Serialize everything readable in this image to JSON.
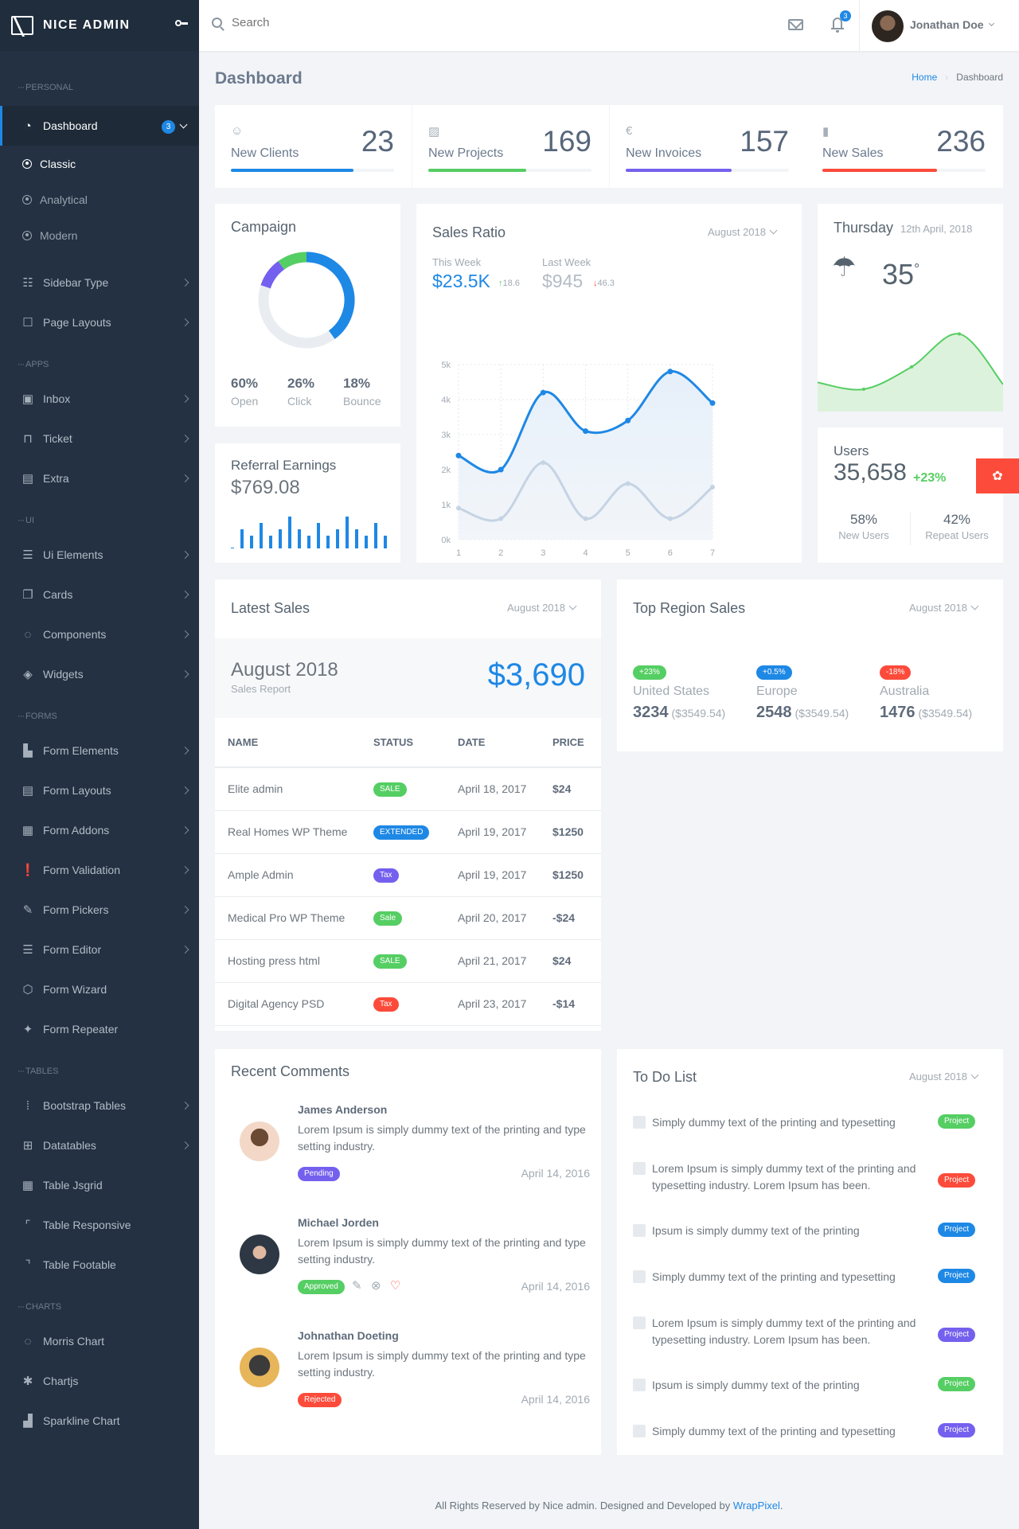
{
  "brand": {
    "name": "NICE ADMIN"
  },
  "search": {
    "placeholder": "Search"
  },
  "header": {
    "notification_count": "3",
    "user_name": "Jonathan Doe"
  },
  "page": {
    "title": "Dashboard",
    "breadcrumb": [
      "Home",
      "Dashboard"
    ]
  },
  "sidebar": {
    "sections": {
      "personal": "PERSONAL",
      "apps": "APPS",
      "ui": "UI",
      "forms": "FORMS",
      "tables": "TABLES",
      "charts": "CHARTS"
    },
    "dashboard": {
      "label": "Dashboard",
      "badge": "3",
      "subitems": [
        "Classic",
        "Analytical",
        "Modern"
      ]
    },
    "personal_items": [
      "Sidebar Type",
      "Page Layouts"
    ],
    "apps_items": [
      "Inbox",
      "Ticket",
      "Extra"
    ],
    "ui_items": [
      "Ui Elements",
      "Cards",
      "Components",
      "Widgets"
    ],
    "forms_items": [
      "Form Elements",
      "Form Layouts",
      "Form Addons",
      "Form Validation",
      "Form Pickers",
      "Form Editor",
      "Form Wizard",
      "Form Repeater"
    ],
    "tables_items": [
      "Bootstrap Tables",
      "Datatables",
      "Table Jsgrid",
      "Table Responsive",
      "Table Footable"
    ],
    "charts_items": [
      "Morris Chart",
      "Chartjs",
      "Sparkline Chart"
    ]
  },
  "stats": [
    {
      "label": "New Clients",
      "value": "23",
      "icon": "smile-icon",
      "progress": 0.75,
      "color": "#1e88e5"
    },
    {
      "label": "New Projects",
      "value": "169",
      "icon": "image-icon",
      "progress": 0.6,
      "color": "#55ce63"
    },
    {
      "label": "New Invoices",
      "value": "157",
      "icon": "euro-icon",
      "progress": 0.65,
      "color": "#7460ee"
    },
    {
      "label": "New Sales",
      "value": "236",
      "icon": "bar-chart-icon",
      "progress": 0.7,
      "color": "#fc4b3b"
    }
  ],
  "campaign": {
    "title": "Campaign",
    "stats": [
      {
        "value": "60%",
        "label": "Open"
      },
      {
        "value": "26%",
        "label": "Click"
      },
      {
        "value": "18%",
        "label": "Bounce"
      }
    ]
  },
  "referral": {
    "title": "Referral Earnings",
    "amount": "$769.08"
  },
  "sales_ratio": {
    "title": "Sales Ratio",
    "period": "August 2018",
    "this_week_label": "This Week",
    "this_week_value": "$23.5K",
    "this_week_change": "18.6",
    "last_week_label": "Last Week",
    "last_week_value": "$945",
    "last_week_change": "46.3"
  },
  "weather": {
    "day": "Thursday",
    "date": "12th April, 2018",
    "temp": "35",
    "unit": "°"
  },
  "users": {
    "title": "Users",
    "count": "35,658",
    "change": "+23%",
    "new_pct": "58%",
    "new_label": "New Users",
    "repeat_pct": "42%",
    "repeat_label": "Repeat Users"
  },
  "latest_sales": {
    "title": "Latest Sales",
    "period": "August 2018",
    "report_month": "August 2018",
    "report_label": "Sales Report",
    "total": "$3,690",
    "columns": [
      "NAME",
      "STATUS",
      "DATE",
      "PRICE"
    ],
    "rows": [
      {
        "name": "Elite admin",
        "status": "SALE",
        "status_color": "#55ce63",
        "date": "April 18, 2017",
        "price": "$24"
      },
      {
        "name": "Real Homes WP Theme",
        "status": "EXTENDED",
        "status_color": "#1e88e5",
        "date": "April 19, 2017",
        "price": "$1250"
      },
      {
        "name": "Ample Admin",
        "status": "Tax",
        "status_color": "#7460ee",
        "date": "April 19, 2017",
        "price": "$1250"
      },
      {
        "name": "Medical Pro WP Theme",
        "status": "Sale",
        "status_color": "#55ce63",
        "date": "April 20, 2017",
        "price": "-$24"
      },
      {
        "name": "Hosting press html",
        "status": "SALE",
        "status_color": "#55ce63",
        "date": "April 21, 2017",
        "price": "$24"
      },
      {
        "name": "Digital Agency PSD",
        "status": "Tax",
        "status_color": "#fc4b3b",
        "date": "April 23, 2017",
        "price": "-$14"
      }
    ]
  },
  "top_region": {
    "title": "Top Region Sales",
    "period": "August 2018",
    "regions": [
      {
        "change": "+23%",
        "color": "#55ce63",
        "name": "United States",
        "count": "3234",
        "amount": "($3549.54)"
      },
      {
        "change": "+0.5%",
        "color": "#1e88e5",
        "name": "Europe",
        "count": "2548",
        "amount": "($3549.54)"
      },
      {
        "change": "-18%",
        "color": "#fc4b3b",
        "name": "Australia",
        "count": "1476",
        "amount": "($3549.54)"
      }
    ]
  },
  "comments": {
    "title": "Recent Comments",
    "items": [
      {
        "name": "James Anderson",
        "text": "Lorem Ipsum is simply dummy text of the printing and type setting industry.",
        "status": "Pending",
        "status_color": "#7460ee",
        "date": "April 14, 2016"
      },
      {
        "name": "Michael Jorden",
        "text": "Lorem Ipsum is simply dummy text of the printing and type setting industry.",
        "status": "Approved",
        "status_color": "#55ce63",
        "date": "April 14, 2016"
      },
      {
        "name": "Johnathan Doeting",
        "text": "Lorem Ipsum is simply dummy text of the printing and type setting industry.",
        "status": "Rejected",
        "status_color": "#fc4b3b",
        "date": "April 14, 2016"
      }
    ]
  },
  "todo": {
    "title": "To Do List",
    "period": "August 2018",
    "items": [
      {
        "text": "Simply dummy text of the printing and typesetting",
        "tag": "Project",
        "color": "#55ce63"
      },
      {
        "text": "Lorem Ipsum is simply dummy text of the printing and typesetting industry. Lorem Ipsum has been.",
        "tag": "Project",
        "color": "#fc4b3b"
      },
      {
        "text": "Ipsum is simply dummy text of the printing",
        "tag": "Project",
        "color": "#1e88e5"
      },
      {
        "text": "Simply dummy text of the printing and typesetting",
        "tag": "Project",
        "color": "#1e88e5"
      },
      {
        "text": "Lorem Ipsum is simply dummy text of the printing and typesetting industry. Lorem Ipsum has been.",
        "tag": "Project",
        "color": "#7460ee"
      },
      {
        "text": "Ipsum is simply dummy text of the printing",
        "tag": "Project",
        "color": "#55ce63"
      },
      {
        "text": "Simply dummy text of the printing and typesetting",
        "tag": "Project",
        "color": "#7460ee"
      }
    ]
  },
  "footer": {
    "text": "All Rights Reserved by Nice admin. Designed and Developed by ",
    "link": "WrapPixel",
    "suffix": "."
  },
  "chart_data": [
    {
      "type": "line",
      "title": "Sales Ratio",
      "x": [
        1,
        2,
        3,
        4,
        5,
        6,
        7
      ],
      "series": [
        {
          "name": "This Week",
          "values": [
            2.4,
            2.0,
            4.2,
            3.1,
            3.4,
            4.8,
            3.9
          ],
          "color": "#1e88e5"
        },
        {
          "name": "Last Week",
          "values": [
            0.9,
            0.6,
            2.2,
            0.6,
            1.6,
            0.6,
            1.5
          ],
          "color": "#c5d3e3"
        }
      ],
      "ytick_labels": [
        "0k",
        "1k",
        "2k",
        "3k",
        "4k",
        "5k"
      ],
      "ylim": [
        0,
        5
      ],
      "grid": true
    },
    {
      "type": "pie",
      "title": "Campaign",
      "categories": [
        "Open",
        "Bounce",
        "Click",
        "Remaining"
      ],
      "values": [
        40,
        10,
        10,
        40
      ],
      "colors": [
        "#1e88e5",
        "#7460ee",
        "#55ce63",
        "#e9edf2"
      ]
    },
    {
      "type": "bar",
      "title": "Referral Earnings",
      "values": [
        0,
        3,
        2,
        4,
        2,
        3,
        5,
        3,
        2,
        4,
        2,
        3,
        5,
        3,
        2,
        4,
        2
      ],
      "color": "#1e88e5"
    },
    {
      "type": "area",
      "title": "Weather",
      "values": [
        3,
        2.3,
        4.6,
        8,
        2.8
      ],
      "color": "#55ce63"
    }
  ]
}
